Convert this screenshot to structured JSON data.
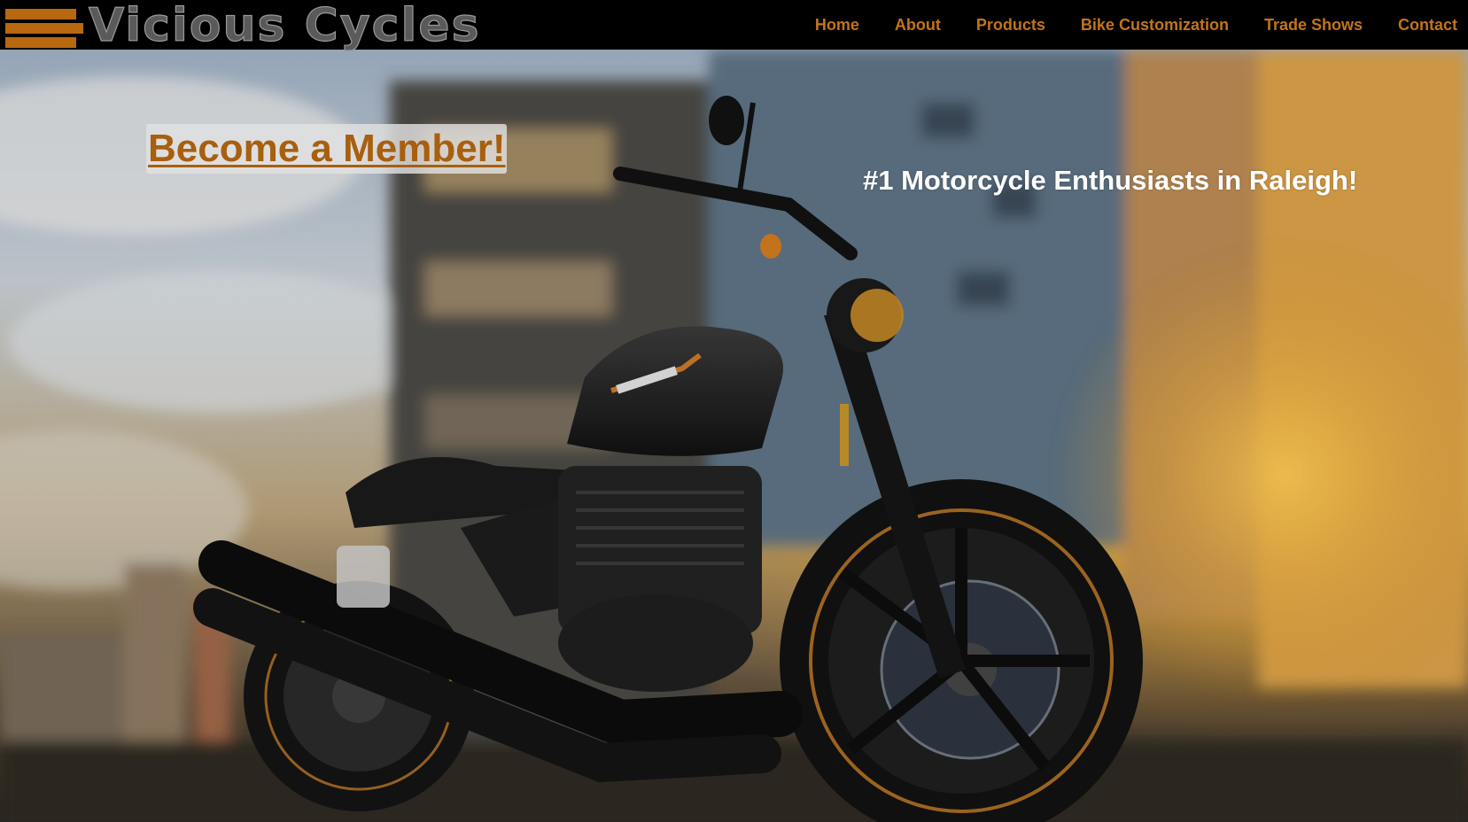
{
  "brand": {
    "name": "Vicious Cycles",
    "accent_color": "#c2741b",
    "logo_icon": "stripes-logo-icon"
  },
  "nav": {
    "items": [
      {
        "label": "Home"
      },
      {
        "label": "About"
      },
      {
        "label": "Products"
      },
      {
        "label": "Bike Customization"
      },
      {
        "label": "Trade Shows"
      },
      {
        "label": "Contact"
      }
    ]
  },
  "hero": {
    "cta_label": "Become a Member!",
    "tagline": "#1 Motorcycle Enthusiasts in Raleigh!",
    "image_subject": "motorcycle-photo"
  }
}
